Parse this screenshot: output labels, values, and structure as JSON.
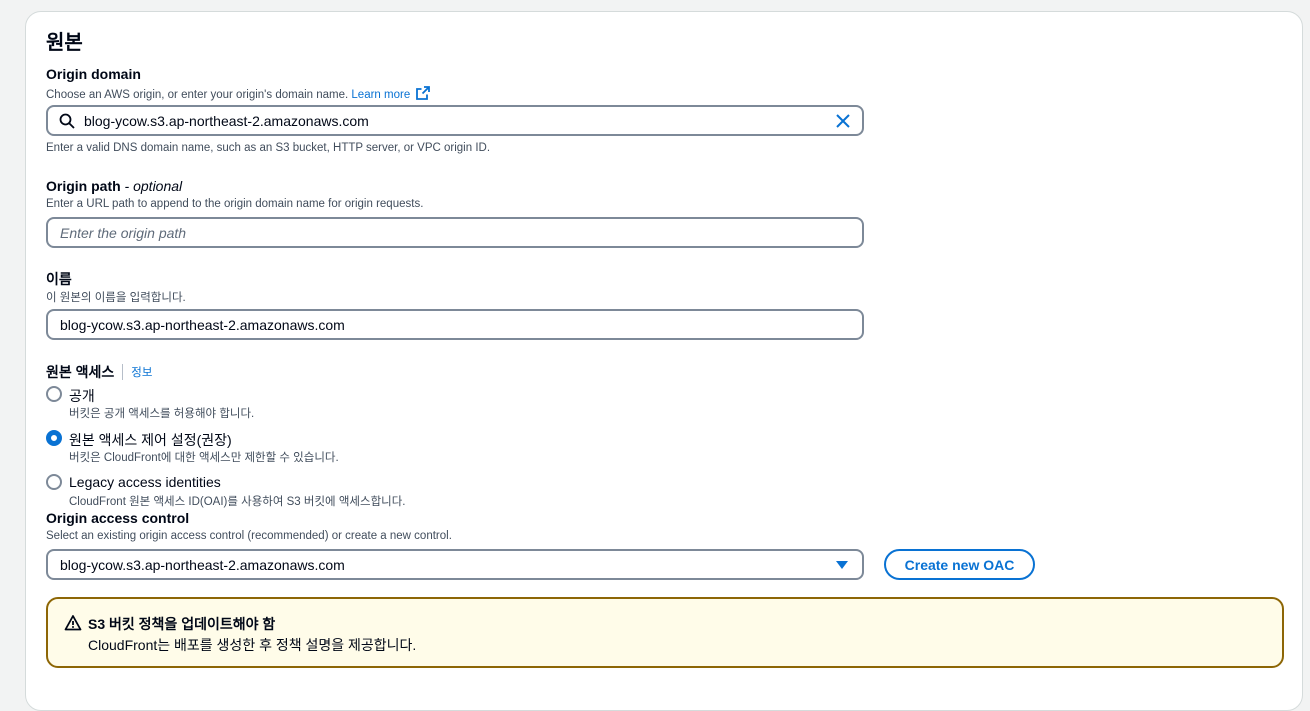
{
  "section": {
    "title": "원본"
  },
  "origin_domain": {
    "label": "Origin domain",
    "description": "Choose an AWS origin, or enter your origin's domain name.",
    "learn_more": "Learn more",
    "value": "blog-ycow.s3.ap-northeast-2.amazonaws.com",
    "hint": "Enter a valid DNS domain name, such as an S3 bucket, HTTP server, or VPC origin ID."
  },
  "origin_path": {
    "label": "Origin path",
    "optional": " - optional",
    "description": "Enter a URL path to append to the origin domain name for origin requests.",
    "placeholder": "Enter the origin path"
  },
  "name": {
    "label": "이름",
    "description": "이 원본의 이름을 입력합니다.",
    "value": "blog-ycow.s3.ap-northeast-2.amazonaws.com"
  },
  "origin_access": {
    "label": "원본 액세스",
    "info": "정보",
    "options": [
      {
        "label": "공개",
        "description": "버킷은 공개 액세스를 허용해야 합니다.",
        "selected": false
      },
      {
        "label": "원본 액세스 제어 설정(권장)",
        "description": "버킷은 CloudFront에 대한 액세스만 제한할 수 있습니다.",
        "selected": true
      },
      {
        "label": "Legacy access identities",
        "description": "CloudFront 원본 액세스 ID(OAI)를 사용하여 S3 버킷에 액세스합니다.",
        "selected": false
      }
    ]
  },
  "oac": {
    "label": "Origin access control",
    "description": "Select an existing origin access control (recommended) or create a new control.",
    "selected": "blog-ycow.s3.ap-northeast-2.amazonaws.com",
    "create_button": "Create new OAC"
  },
  "alert": {
    "title": "S3 버킷 정책을 업데이트해야 함",
    "body": "CloudFront는 배포를 생성한 후 정책 설명을 제공합니다."
  },
  "colors": {
    "accent": "#0972d3",
    "warning_border": "#8d6605",
    "warning_bg": "#fffce9"
  }
}
